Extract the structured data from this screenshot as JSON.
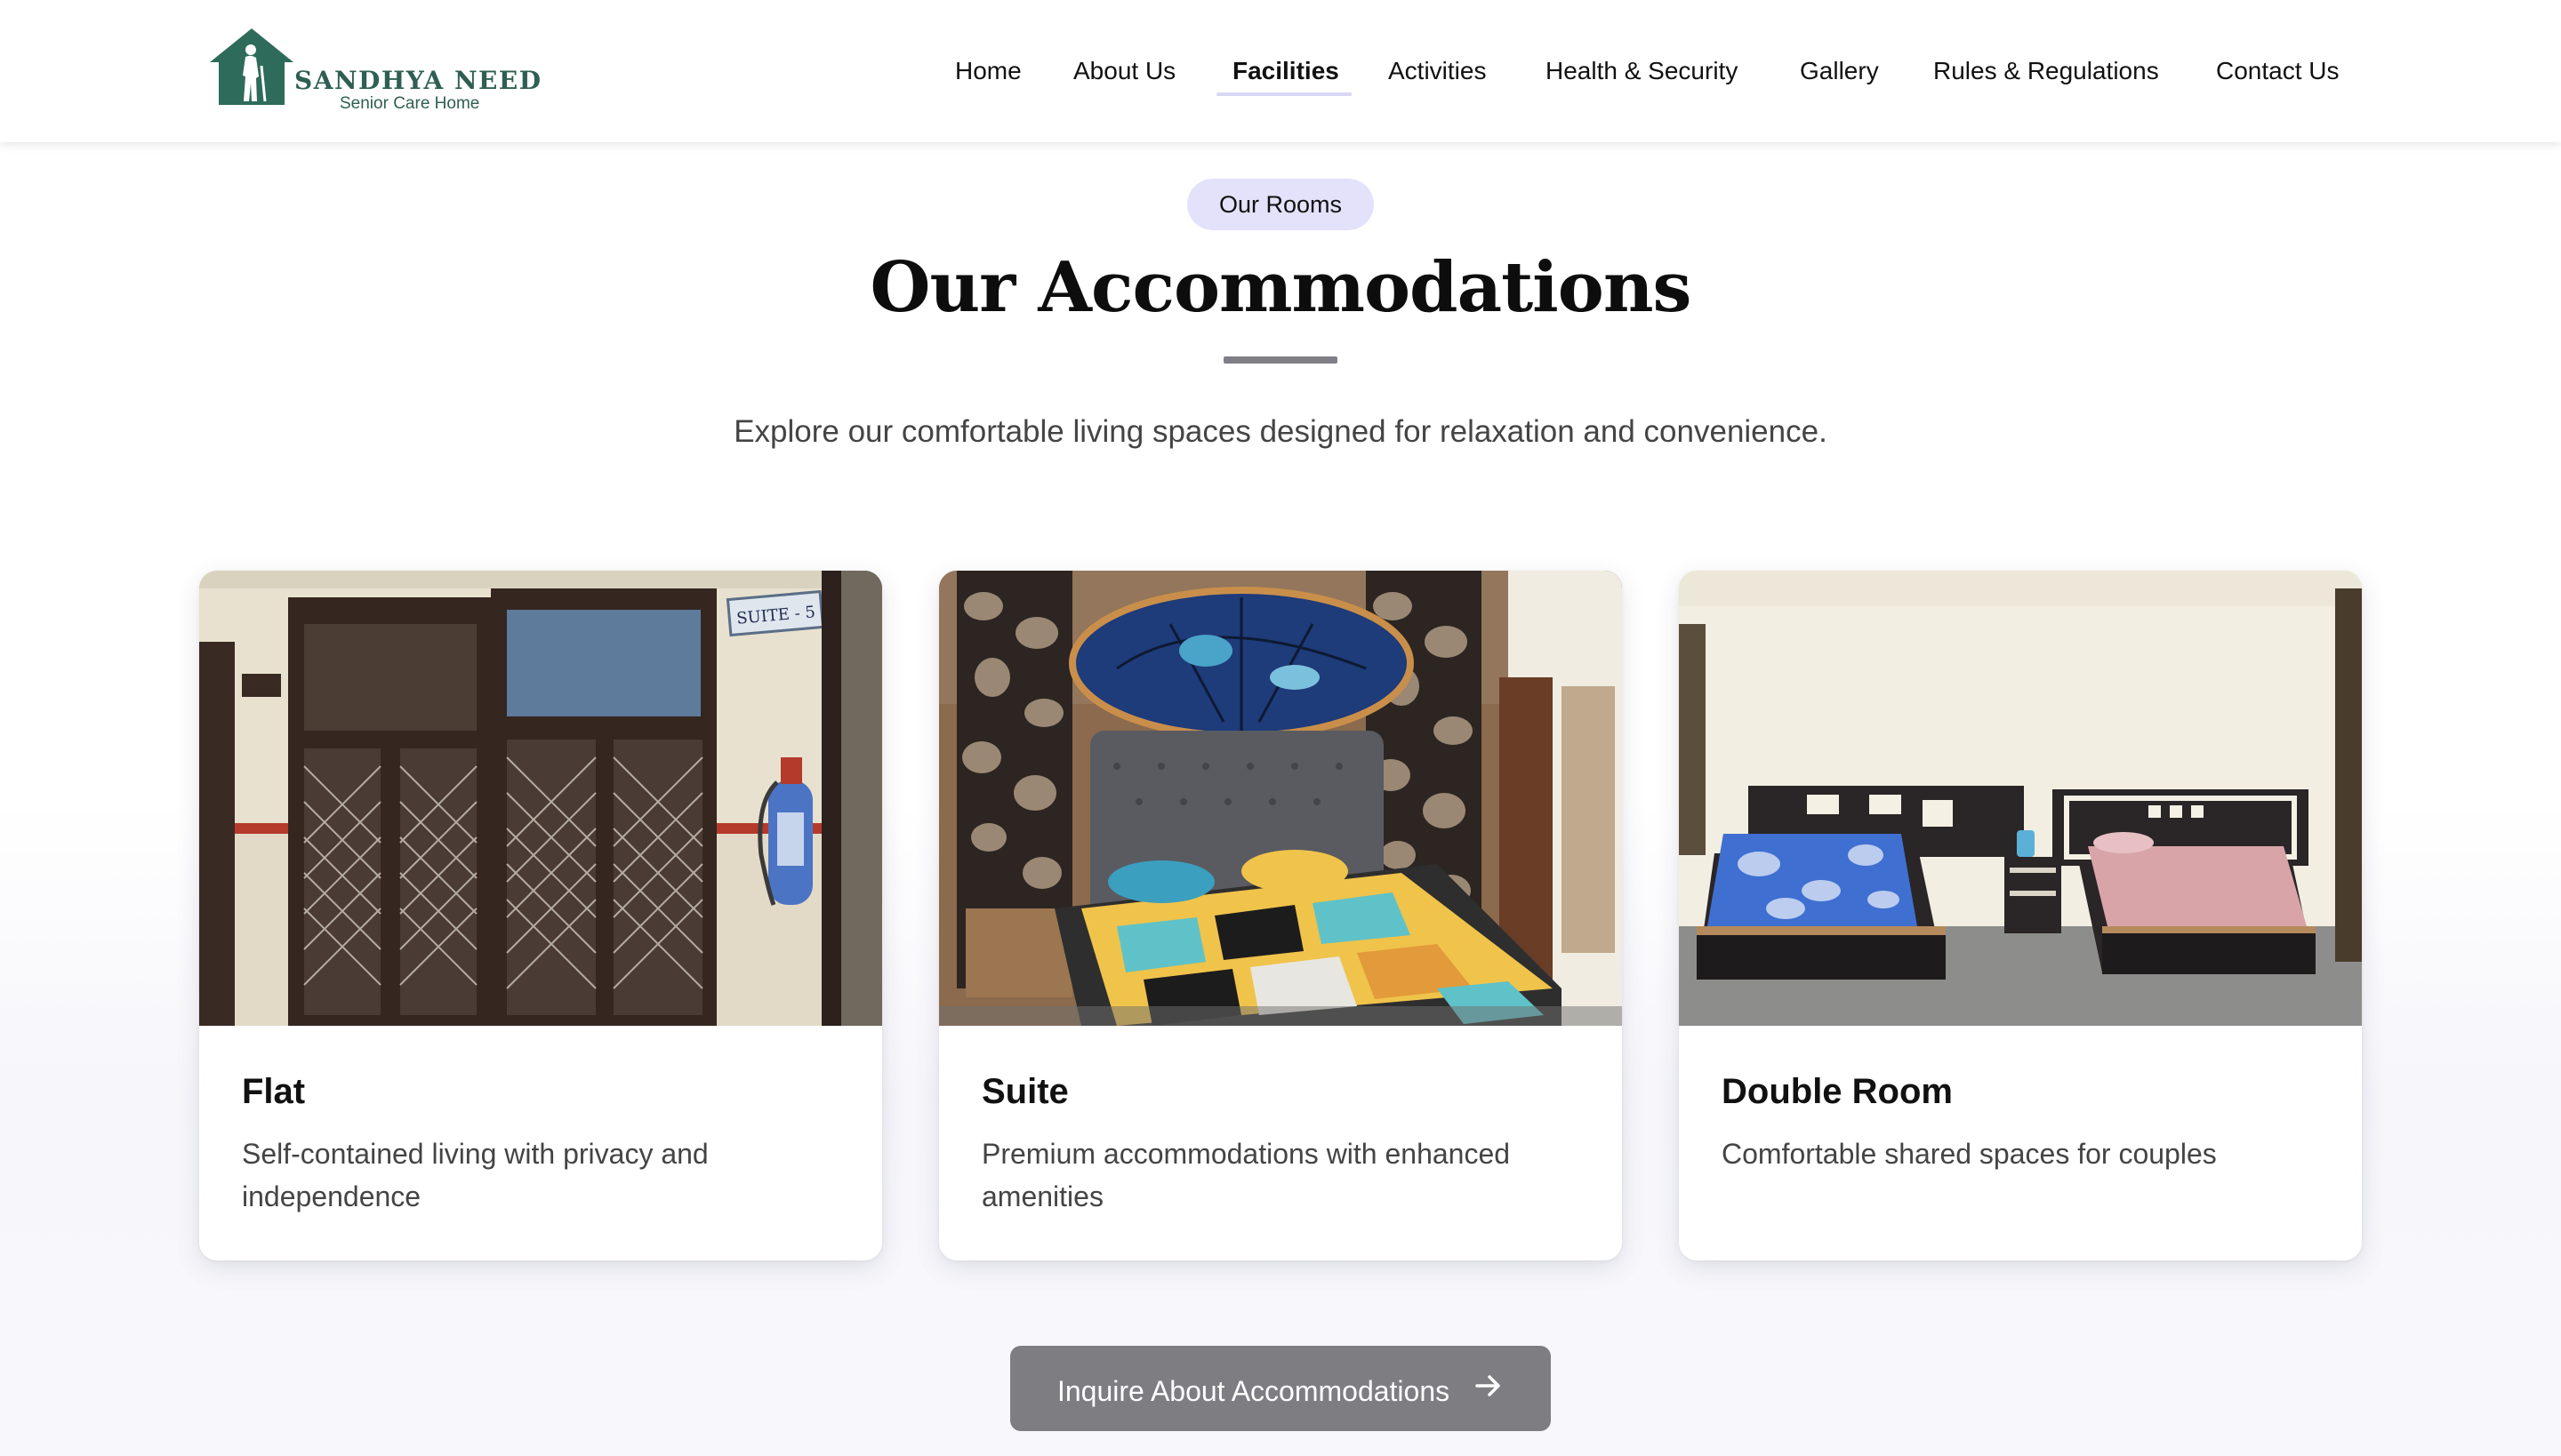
{
  "brand": {
    "name": "SANDHYA NEED",
    "tagline": "Senior Care Home",
    "color": "#2f5f52"
  },
  "nav": {
    "items": [
      {
        "label": "Home"
      },
      {
        "label": "About Us"
      },
      {
        "label": "Facilities",
        "active": true
      },
      {
        "label": "Activities"
      },
      {
        "label": "Health & Security"
      },
      {
        "label": "Gallery"
      },
      {
        "label": "Rules & Regulations"
      },
      {
        "label": "Contact Us"
      }
    ]
  },
  "section": {
    "badge": "Our Rooms",
    "title": "Our Accommodations",
    "subtitle": "Explore our comfortable living spaces designed for relaxation and convenience."
  },
  "cards": [
    {
      "title": "Flat",
      "description": "Self-contained living with privacy and independence",
      "image_sign": "SUITE - 5"
    },
    {
      "title": "Suite",
      "description": "Premium accommodations with enhanced amenities"
    },
    {
      "title": "Double Room",
      "description": "Comfortable shared spaces for couples"
    }
  ],
  "cta": {
    "label": "Inquire About Accommodations",
    "icon": "arrow-right-icon"
  },
  "colors": {
    "badge_bg": "#e4e1fb",
    "cta_bg": "#7d7d82",
    "active_underline": "#d9d6f5"
  }
}
